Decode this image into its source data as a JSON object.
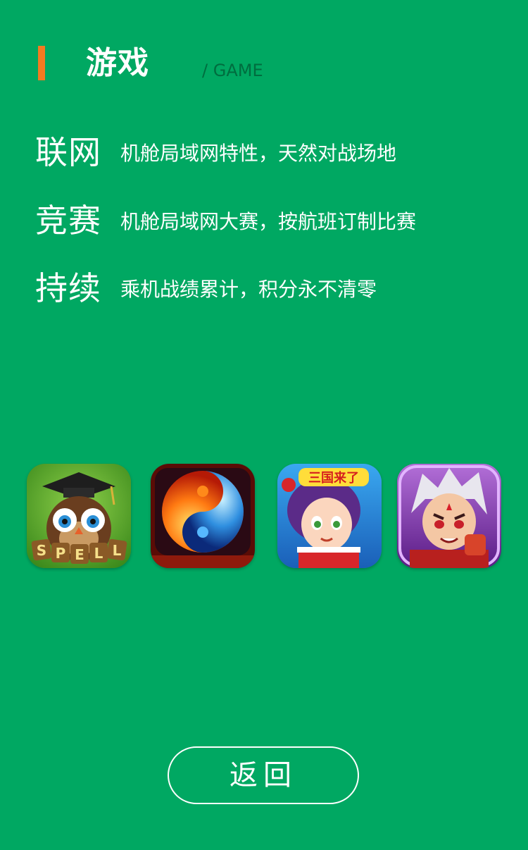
{
  "header": {
    "title": "游戏",
    "subtitle": "/ GAME",
    "accent_color": "#f47a20"
  },
  "features": [
    {
      "title": "联网",
      "description": "机舱局域网特性，天然对战场地"
    },
    {
      "title": "竞赛",
      "description": "机舱局域网大赛，按航班订制比赛"
    },
    {
      "title": "持续",
      "description": "乘机战绩累计，积分永不清零"
    }
  ],
  "games": [
    {
      "icon": "owl-spell-game-icon",
      "text": "SPELL"
    },
    {
      "icon": "fire-ice-yinyang-game-icon"
    },
    {
      "icon": "three-kingdoms-girl-game-icon",
      "text": "三国来了"
    },
    {
      "icon": "white-haired-warrior-game-icon"
    }
  ],
  "back_button": {
    "label": "返回"
  },
  "colors": {
    "background": "#00a862",
    "text": "#ffffff",
    "subtitle": "#006d3f"
  }
}
